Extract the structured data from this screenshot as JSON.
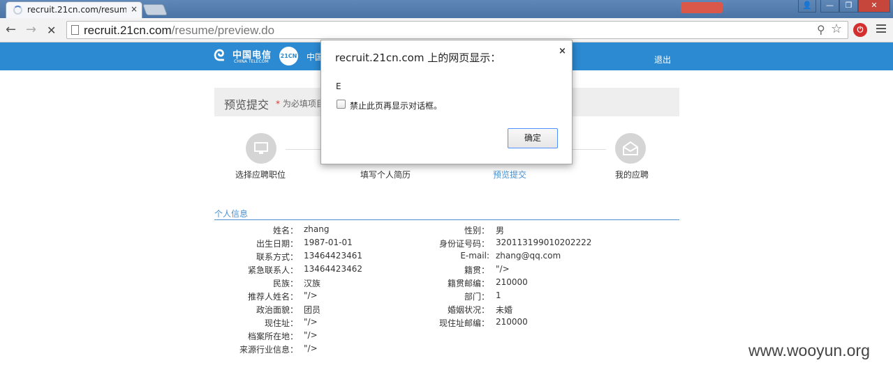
{
  "browser": {
    "tab_title": "recruit.21cn.com/resum",
    "tab_close": "×",
    "back_glyph": "←",
    "forward_glyph": "→",
    "stop_glyph": "✕",
    "url_host": "recruit.21cn.com",
    "url_path": "/resume/preview.do",
    "zoom_glyph": "⚲",
    "star_glyph": "☆",
    "ext_glyph": "⏻",
    "window_min": "—",
    "window_max": "❐",
    "window_close": "✕",
    "user_glyph": "👤"
  },
  "header": {
    "logo_cn": "中国电信",
    "logo_en": "CHINA TELECOM",
    "badge": "21CN",
    "site_name": "中国",
    "logout": "退出"
  },
  "page": {
    "title": "预览提交",
    "required_star": "*",
    "required_note": "为必填项目"
  },
  "steps": [
    {
      "label": "选择应聘职位",
      "active": false
    },
    {
      "label": "填写个人简历",
      "active": false
    },
    {
      "label": "预览提交",
      "active": true
    },
    {
      "label": "我的应聘",
      "active": false
    }
  ],
  "section": {
    "title": "个人信息"
  },
  "left_fields": [
    {
      "label": "姓名：",
      "value": "zhang"
    },
    {
      "label": "出生日期：",
      "value": "1987-01-01"
    },
    {
      "label": "联系方式：",
      "value": "13464423461"
    },
    {
      "label": "紧急联系人：",
      "value": "13464423462"
    },
    {
      "label": "民族：",
      "value": "汉族"
    },
    {
      "label": "推荐人姓名：",
      "value": "\"/>"
    },
    {
      "label": "政治面貌：",
      "value": "团员"
    },
    {
      "label": "现住址：",
      "value": "\"/>"
    },
    {
      "label": "档案所在地：",
      "value": "\"/>"
    },
    {
      "label": "来源行业信息：",
      "value": "\"/>"
    }
  ],
  "right_fields": [
    {
      "label": "性别：",
      "value": "男"
    },
    {
      "label": "身份证号码：",
      "value": "320113199010202222"
    },
    {
      "label": "E-mail:",
      "value": "zhang@qq.com"
    },
    {
      "label": "籍贯：",
      "value": "\"/>"
    },
    {
      "label": "籍贯邮编：",
      "value": "210000"
    },
    {
      "label": "部门：",
      "value": "1"
    },
    {
      "label": "婚姻状况：",
      "value": "未婚"
    },
    {
      "label": "现住址邮编：",
      "value": "210000"
    }
  ],
  "dialog": {
    "title": "recruit.21cn.com 上的网页显示：",
    "close": "×",
    "message": "E",
    "checkbox_label": "禁止此页再显示对话框。",
    "ok_label": "确定"
  },
  "watermark": "www.wooyun.org",
  "colors": {
    "header_blue": "#2b8ad1",
    "accent_blue": "#4a90d0",
    "required_red": "#e0322d"
  }
}
